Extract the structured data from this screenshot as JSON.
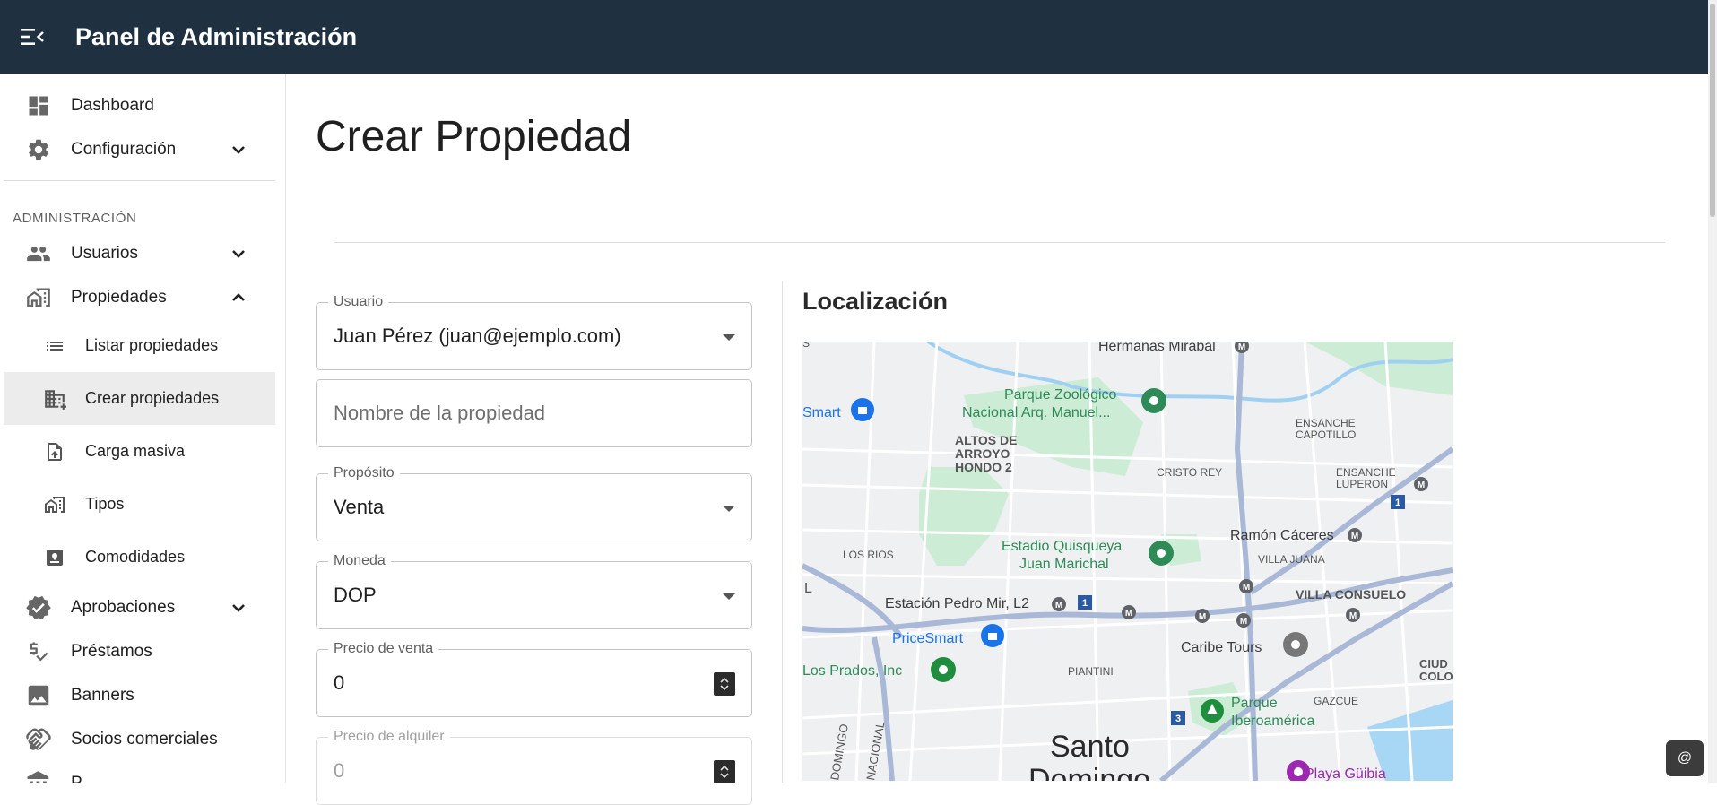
{
  "header": {
    "title": "Panel de Administración"
  },
  "sidebar": {
    "top_items": [
      {
        "label": "Dashboard"
      },
      {
        "label": "Configuración"
      }
    ],
    "section_title": "ADMINISTRACIÓN",
    "items": [
      {
        "label": "Usuarios"
      },
      {
        "label": "Propiedades"
      },
      {
        "label": "Listar propiedades"
      },
      {
        "label": "Crear propiedades"
      },
      {
        "label": "Carga masiva"
      },
      {
        "label": "Tipos"
      },
      {
        "label": "Comodidades"
      },
      {
        "label": "Aprobaciones"
      },
      {
        "label": "Préstamos"
      },
      {
        "label": "Banners"
      },
      {
        "label": "Socios comerciales"
      },
      {
        "label": "P..."
      }
    ]
  },
  "page": {
    "title": "Crear Propiedad",
    "form": {
      "usuario": {
        "label": "Usuario",
        "value": "Juan Pérez (juan@ejemplo.com)"
      },
      "nombre": {
        "placeholder": "Nombre de la propiedad"
      },
      "proposito": {
        "label": "Propósito",
        "value": "Venta"
      },
      "moneda": {
        "label": "Moneda",
        "value": "DOP"
      },
      "precio_venta": {
        "label": "Precio de venta",
        "value": "0"
      },
      "precio_alquiler": {
        "label": "Precio de alquiler",
        "value": "0"
      }
    },
    "location": {
      "title": "Localización",
      "map_labels": {
        "hermanas": "Hermanas Mirabal",
        "zoo1": "Parque Zoológico",
        "zoo2": "Nacional Arq. Manuel...",
        "smart": "Smart",
        "altos1": "ALTOS DE",
        "altos2": "ARROYO",
        "altos3": "HONDO 2",
        "ensanche_cap1": "ENSANCHE",
        "ensanche_cap2": "CAPOTILLO",
        "cristo": "CRISTO REY",
        "ensanche_lup1": "ENSANCHE",
        "ensanche_lup2": "LUPERON",
        "estadio1": "Estadio Quisqueya",
        "estadio2": "Juan Marichal",
        "ramon": "Ramón Cáceres",
        "rios": "LOS RIOS",
        "villa_juana": "VILLA JUANA",
        "estacion": "Estación Pedro Mir, L2",
        "villa_consuelo": "VILLA CONSUELO",
        "pricesmart": "PriceSmart",
        "caribe": "Caribe Tours",
        "prados": "Los Prados, Inc",
        "piantini": "PIANTINI",
        "ciud": "CIUD",
        "colo": "COLO",
        "gazcue": "GAZCUE",
        "parque_ibero1": "Parque",
        "parque_ibero2": "Iberoamérica",
        "santo1": "Santo",
        "santo2": "Domingo",
        "playa": "Playa Güibia",
        "domingo_road": "DOMINGO",
        "nacional_road": "NACIONAL",
        "l": "L",
        "s": "S",
        "shield1": "1",
        "shield3": "3",
        "m": "M"
      }
    }
  },
  "corner_button": {
    "label": "@"
  },
  "colors": {
    "header_bg": "#1f3140",
    "active_item": "#ececec"
  }
}
